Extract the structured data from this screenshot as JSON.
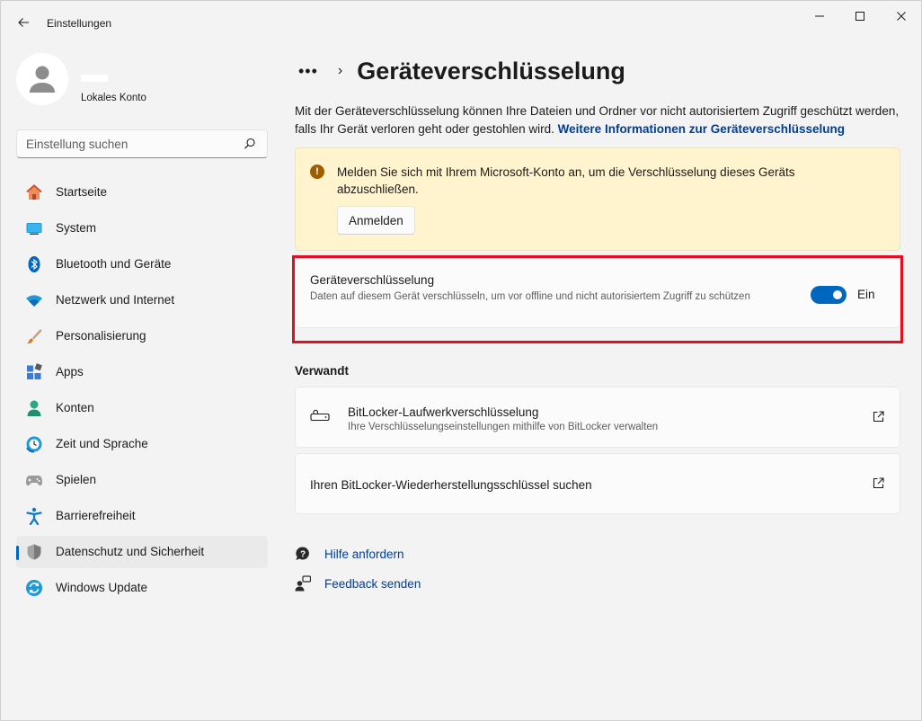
{
  "app": {
    "title": "Einstellungen",
    "back_icon": "arrow-left-icon",
    "window_controls": [
      "minimize-icon",
      "maximize-icon",
      "close-icon"
    ]
  },
  "profile": {
    "account_type": "Lokales Konto"
  },
  "search": {
    "placeholder": "Einstellung suchen",
    "icon": "search-icon"
  },
  "nav": {
    "items": [
      {
        "label": "Startseite",
        "icon": "home-icon"
      },
      {
        "label": "System",
        "icon": "system-icon"
      },
      {
        "label": "Bluetooth und Geräte",
        "icon": "bluetooth-icon"
      },
      {
        "label": "Netzwerk und Internet",
        "icon": "wifi-icon"
      },
      {
        "label": "Personalisierung",
        "icon": "brush-icon"
      },
      {
        "label": "Apps",
        "icon": "apps-icon"
      },
      {
        "label": "Konten",
        "icon": "person-icon"
      },
      {
        "label": "Zeit und Sprache",
        "icon": "clock-globe-icon"
      },
      {
        "label": "Spielen",
        "icon": "gamepad-icon"
      },
      {
        "label": "Barrierefreiheit",
        "icon": "accessibility-icon"
      },
      {
        "label": "Datenschutz und Sicherheit",
        "icon": "shield-icon",
        "active": true
      },
      {
        "label": "Windows Update",
        "icon": "update-icon"
      }
    ]
  },
  "breadcrumb": {
    "more": "•••",
    "separator": "›",
    "title": "Geräteverschlüsselung"
  },
  "intro": {
    "text": "Mit der Geräteverschlüsselung können Ihre Dateien und Ordner vor nicht autorisiertem Zugriff geschützt werden, falls Ihr Gerät verloren geht oder gestohlen wird.",
    "link": "Weitere Informationen zur Geräteverschlüsselung"
  },
  "warning": {
    "text": "Melden Sie sich mit Ihrem Microsoft-Konto an, um die Verschlüsselung dieses Geräts abzuschließen.",
    "button": "Anmelden",
    "icon": "warning-icon"
  },
  "encryption": {
    "title": "Geräteverschlüsselung",
    "description": "Daten auf diesem Gerät verschlüsseln, um vor offline und nicht autorisiertem Zugriff zu schützen",
    "toggle_state": "Ein",
    "enabled": true
  },
  "related": {
    "heading": "Verwandt",
    "items": [
      {
        "title": "BitLocker-Laufwerkverschlüsselung",
        "subtitle": "Ihre Verschlüsselungseinstellungen mithilfe von BitLocker verwalten",
        "icon": "bitlocker-key-icon"
      },
      {
        "title": "Ihren BitLocker-Wiederherstellungsschlüssel suchen"
      }
    ]
  },
  "help": {
    "get_help": "Hilfe anfordern",
    "feedback": "Feedback senden"
  },
  "colors": {
    "accent": "#0067c0",
    "highlight": "#e0101e",
    "warning_bg": "#fff4ce",
    "link": "#003e92"
  }
}
